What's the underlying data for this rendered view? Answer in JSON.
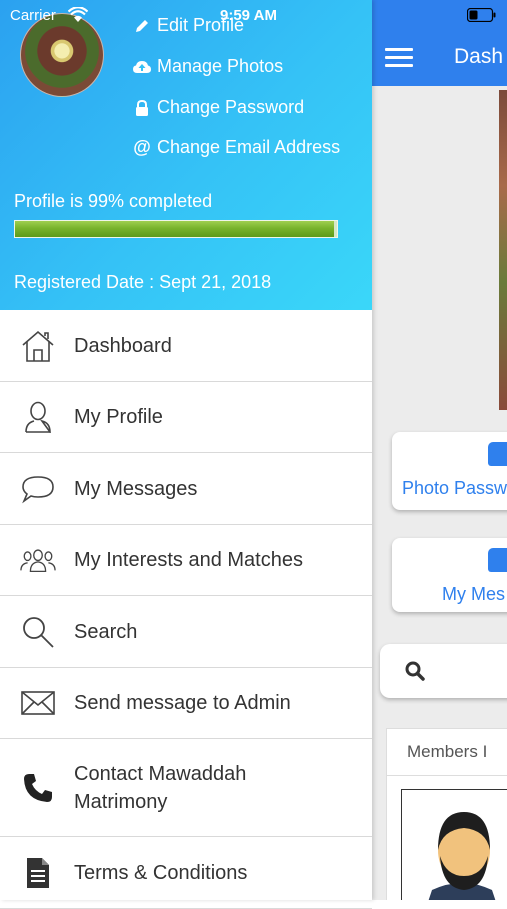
{
  "status_bar": {
    "carrier": "Carrier",
    "time": "9:59 AM"
  },
  "background_app": {
    "nav_title": "Dash",
    "card_photo_label": "Photo Passw",
    "card_messages_label": "My Mes",
    "members_header": "Members I",
    "accent_color": "#2f80ed"
  },
  "drawer": {
    "profile_links": [
      {
        "label": "Edit Profile",
        "icon": "pencil-icon"
      },
      {
        "label": "Manage Photos",
        "icon": "cloud-upload-icon"
      },
      {
        "label": "Change Password",
        "icon": "lock-icon"
      },
      {
        "label": "Change Email Address",
        "icon": "at-sign-icon"
      }
    ],
    "profile_completion_text": "Profile is 99% completed",
    "profile_completion_percent": 99,
    "registered_date": "Registered Date : Sept 21, 2018",
    "header_gradient": [
      "#2ba1f0",
      "#3ad7f9"
    ],
    "menu_items": [
      {
        "label": "Dashboard",
        "icon": "home-icon"
      },
      {
        "label": "My Profile",
        "icon": "user-icon"
      },
      {
        "label": "My Messages",
        "icon": "speech-bubble-icon"
      },
      {
        "label": "My Interests and Matches",
        "icon": "group-icon"
      },
      {
        "label": "Search",
        "icon": "search-icon"
      },
      {
        "label": "Send message to Admin",
        "icon": "envelope-icon"
      },
      {
        "label": "Contact Mawaddah Matrimony",
        "icon": "phone-icon"
      },
      {
        "label": "Terms & Conditions",
        "icon": "document-icon"
      }
    ]
  }
}
